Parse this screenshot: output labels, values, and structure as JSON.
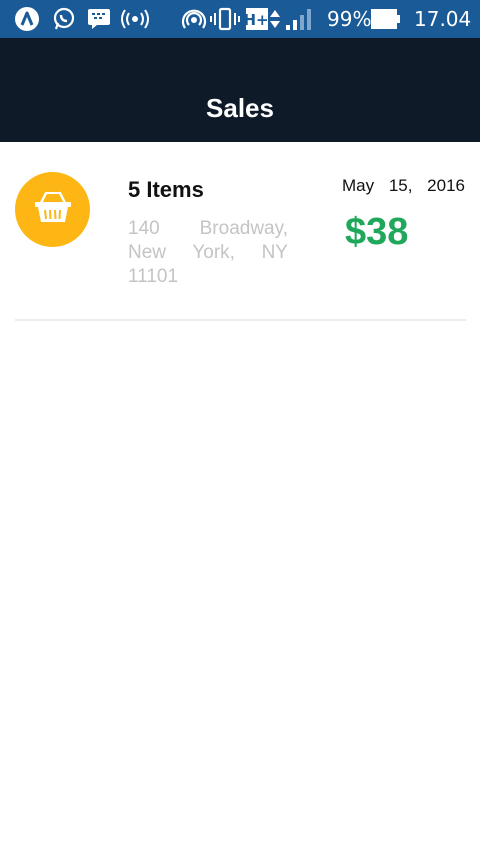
{
  "status_bar": {
    "battery_percent": "99%",
    "time": "17.04",
    "network_type": "H+",
    "icons": [
      "app-a-icon",
      "whatsapp-icon",
      "bbm-icon",
      "broadcast-icon",
      "hotspot-icon",
      "vibrate-icon",
      "network-type-icon",
      "data-arrows-icon",
      "signal-icon",
      "battery-icon"
    ]
  },
  "app_bar": {
    "title": "Sales"
  },
  "sales": [
    {
      "items": "5 Items",
      "address": "140 Broadway, New York, NY 11101",
      "date": "May 15, 2016",
      "amount": "$38",
      "icon": "shopping-basket-icon"
    }
  ],
  "colors": {
    "status_bar_bg": "#1a5a96",
    "app_bar_bg": "#0e1a28",
    "avatar_bg": "#fdb613",
    "amount_text": "#1fa85a",
    "address_text": "#c4c4c4"
  }
}
